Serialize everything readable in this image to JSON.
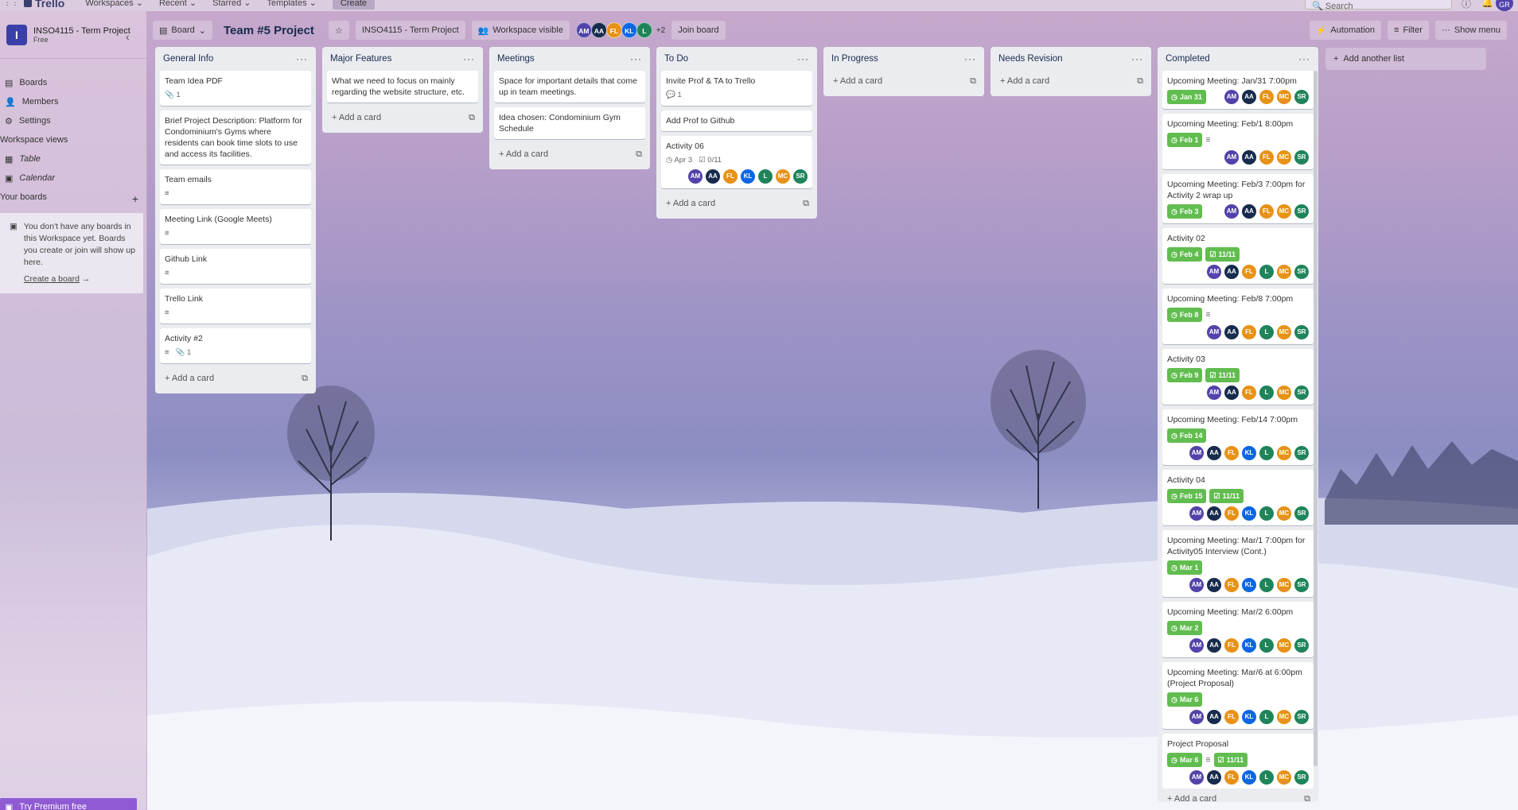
{
  "app": {
    "logo": "Trello",
    "menus": [
      "Workspaces",
      "Recent",
      "Starred",
      "Templates"
    ],
    "create": "Create",
    "search_placeholder": "Search",
    "user_initials": "GR"
  },
  "sidebar": {
    "workspace_name": "INSO4115 - Term Project",
    "plan": "Free",
    "badge": "I",
    "items": [
      {
        "label": "Boards",
        "icon": "board-icon"
      },
      {
        "label": "Members",
        "icon": "person-icon"
      },
      {
        "label": "Settings",
        "icon": "gear-icon"
      }
    ],
    "views_title": "Workspace views",
    "views": [
      {
        "label": "Table",
        "icon": "table-icon"
      },
      {
        "label": "Calendar",
        "icon": "calendar-icon"
      }
    ],
    "your_boards": "Your boards",
    "empty_text": "You don't have any boards in this Workspace yet. Boards you create or join will show up here.",
    "create_board": "Create a board",
    "premium": "Try Premium free"
  },
  "boardbar": {
    "view": "Board",
    "title": "Team #5 Project",
    "workspace": "INSO4115 - Term Project",
    "visibility": "Workspace visible",
    "members": [
      {
        "i": "AM",
        "c": "#5243aa"
      },
      {
        "i": "AA",
        "c": "#172b4d"
      },
      {
        "i": "FL",
        "c": "#e79217"
      },
      {
        "i": "KL",
        "c": "#0c66e4"
      },
      {
        "i": "L",
        "c": "#1f845a"
      }
    ],
    "more": "+2",
    "join": "Join board",
    "automation": "Automation",
    "filter": "Filter",
    "show_menu": "Show menu"
  },
  "colors": {
    "green_badge": "#61bd4f"
  },
  "lists": [
    {
      "title": "General Info",
      "cards": [
        {
          "title": "Team Idea PDF",
          "attach": "1"
        },
        {
          "title": "Brief Project Description: Platform for Condominium's Gyms where residents can book time slots to use and access its facilities."
        },
        {
          "title": "Team emails",
          "desc": true
        },
        {
          "title": "Meeting Link (Google Meets)",
          "desc": true
        },
        {
          "title": "Github Link",
          "desc": true
        },
        {
          "title": "Trello Link",
          "desc": true
        },
        {
          "title": "Activity #2",
          "desc": true,
          "attach": "1"
        }
      ]
    },
    {
      "title": "Major Features",
      "cards": [
        {
          "title": "What we need to focus on mainly regarding the website structure, etc."
        }
      ]
    },
    {
      "title": "Meetings",
      "cards": [
        {
          "title": "Space for important details that come up in team meetings."
        },
        {
          "title": "Idea chosen: Condominium Gym Schedule"
        }
      ]
    },
    {
      "title": "To Do",
      "cards": [
        {
          "title": "Invite Prof & TA to Trello",
          "comments": "1"
        },
        {
          "title": "Add Prof to Github"
        },
        {
          "title": "Activity 06",
          "due": "Apr 3",
          "check": "0/11",
          "members": [
            "AM",
            "AA",
            "FL",
            "KL",
            "L",
            "MC",
            "SR"
          ]
        }
      ]
    },
    {
      "title": "In Progress",
      "cards": []
    },
    {
      "title": "Needs Revision",
      "cards": []
    },
    {
      "title": "Completed",
      "cards": [
        {
          "title": "Upcoming Meeting: Jan/31 7:00pm",
          "date": "Jan 31",
          "members": [
            "AM",
            "AA",
            "FL",
            "MC",
            "SR"
          ],
          "inline": true
        },
        {
          "title": "Upcoming Meeting: Feb/1 8:00pm",
          "date": "Feb 1",
          "desc": true,
          "members": [
            "AM",
            "AA",
            "FL",
            "MC",
            "SR"
          ]
        },
        {
          "title": "Upcoming Meeting: Feb/3 7:00pm for Activity 2 wrap up",
          "date": "Feb 3",
          "members": [
            "AM",
            "AA",
            "FL",
            "MC",
            "SR"
          ],
          "inline": true
        },
        {
          "title": "Activity 02",
          "date": "Feb 4",
          "check": "11/11",
          "members": [
            "AM",
            "AA",
            "FL",
            "L",
            "MC",
            "SR"
          ]
        },
        {
          "title": "Upcoming Meeting: Feb/8 7:00pm",
          "date": "Feb 8",
          "desc": true,
          "members": [
            "AM",
            "AA",
            "FL",
            "L",
            "MC",
            "SR"
          ]
        },
        {
          "title": "Activity 03",
          "date": "Feb 9",
          "check": "11/11",
          "members": [
            "AM",
            "AA",
            "FL",
            "L",
            "MC",
            "SR"
          ]
        },
        {
          "title": "Upcoming Meeting: Feb/14 7:00pm",
          "date": "Feb 14",
          "members": [
            "AM",
            "AA",
            "FL",
            "KL",
            "L",
            "MC",
            "SR"
          ]
        },
        {
          "title": "Activity 04",
          "date": "Feb 15",
          "check": "11/11",
          "members": [
            "AM",
            "AA",
            "FL",
            "KL",
            "L",
            "MC",
            "SR"
          ]
        },
        {
          "title": "Upcoming Meeting: Mar/1 7:00pm for Activity05 Interview (Cont.)",
          "date": "Mar 1",
          "members": [
            "AM",
            "AA",
            "FL",
            "KL",
            "L",
            "MC",
            "SR"
          ]
        },
        {
          "title": "Upcoming Meeting: Mar/2 6:00pm",
          "date": "Mar 2",
          "members": [
            "AM",
            "AA",
            "FL",
            "KL",
            "L",
            "MC",
            "SR"
          ]
        },
        {
          "title": "Upcoming Meeting: Mar/6 at 6:00pm (Project Proposal)",
          "date": "Mar 6",
          "members": [
            "AM",
            "AA",
            "FL",
            "KL",
            "L",
            "MC",
            "SR"
          ]
        },
        {
          "title": "Project Proposal",
          "date": "Mar 6",
          "desc": true,
          "check": "11/11",
          "members": [
            "AM",
            "AA",
            "FL",
            "KL",
            "L",
            "MC",
            "SR"
          ]
        }
      ]
    }
  ],
  "add_card": "Add a card",
  "add_list": "Add another list",
  "member_colors": {
    "AM": "#5243aa",
    "AA": "#172b4d",
    "FL": "#e79217",
    "KL": "#0c66e4",
    "L": "#1f845a",
    "MC": "#e79217",
    "SR": "#1f845a"
  }
}
